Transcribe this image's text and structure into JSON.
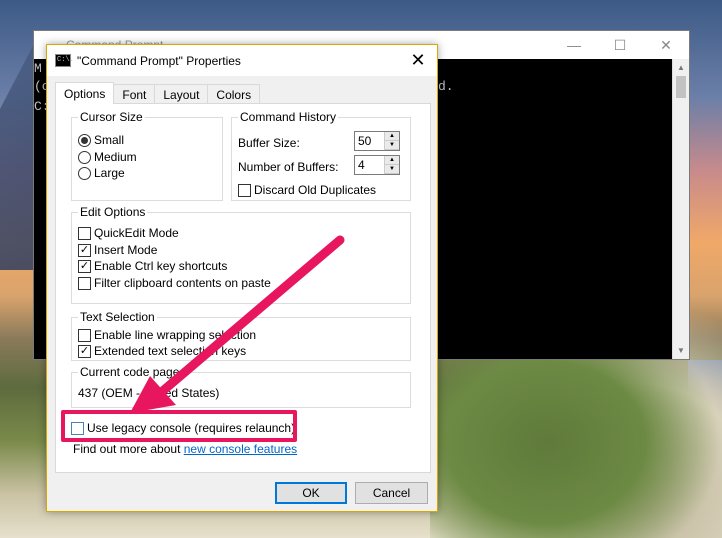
{
  "console": {
    "title": "Command Prompt",
    "lines": [
      "M",
      "(c",
      "",
      "C:"
    ],
    "line_tail": "d.",
    "controls": {
      "minimize": "—",
      "maximize": "☐",
      "close": "✕"
    }
  },
  "dialog": {
    "icon_text": "C:\\.",
    "title": "\"Command Prompt\" Properties",
    "close_glyph": "✕",
    "tabs": [
      "Options",
      "Font",
      "Layout",
      "Colors"
    ],
    "cursor_size": {
      "label": "Cursor Size",
      "options": [
        "Small",
        "Medium",
        "Large"
      ],
      "selected": "Small"
    },
    "command_history": {
      "label": "Command History",
      "buffer_size_label": "Buffer Size:",
      "buffer_size_value": "50",
      "num_buffers_label": "Number of Buffers:",
      "num_buffers_value": "4",
      "discard_label": "Discard Old Duplicates"
    },
    "edit_options": {
      "label": "Edit Options",
      "items": [
        {
          "label": "QuickEdit Mode",
          "checked": false
        },
        {
          "label": "Insert Mode",
          "checked": true
        },
        {
          "label": "Enable Ctrl key shortcuts",
          "checked": true
        },
        {
          "label": "Filter clipboard contents on paste",
          "checked": false
        }
      ]
    },
    "text_selection": {
      "label": "Text Selection",
      "items": [
        {
          "label": "Enable line wrapping selection",
          "checked": false
        },
        {
          "label": "Extended text selection keys",
          "checked": true
        }
      ]
    },
    "code_page": {
      "label": "Current code page",
      "value": "437   (OEM - United States)"
    },
    "legacy_label": "Use legacy console (requires relaunch)",
    "find_more_prefix": "Find out more about ",
    "find_more_link": "new console features",
    "ok_label": "OK",
    "cancel_label": "Cancel",
    "check_glyph": "✓"
  },
  "colors": {
    "highlight": "#e8155f",
    "link": "#0066cc"
  }
}
